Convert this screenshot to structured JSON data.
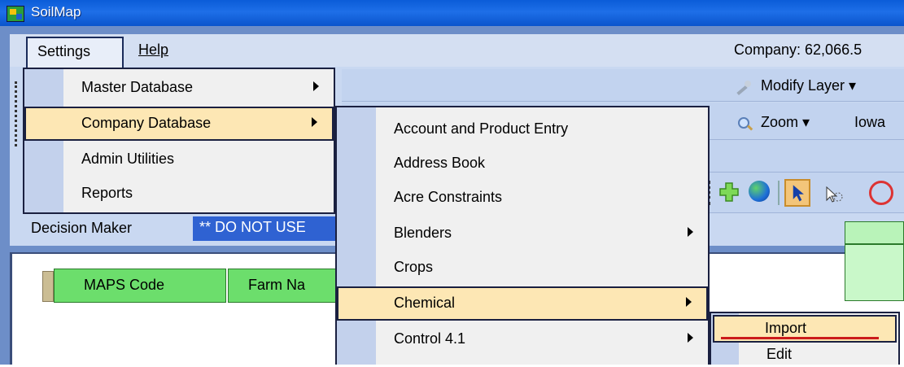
{
  "window": {
    "title": "SoilMap"
  },
  "menubar": {
    "items": [
      "Settings",
      "Help"
    ]
  },
  "status": {
    "company": "Company: 62,066.5"
  },
  "toolbar": {
    "modify_layer": "Modify Layer ▾",
    "zoom": "Zoom ▾",
    "iowa": "Iowa"
  },
  "decision_maker": {
    "label": "Decision Maker",
    "selected": "** DO NOT USE"
  },
  "grid": {
    "columns": [
      "MAPS Code",
      "Farm Na"
    ]
  },
  "settings_menu": {
    "items": [
      "Master Database",
      "Company Database",
      "Admin Utilities",
      "Reports"
    ]
  },
  "company_menu": {
    "items": [
      "Account and Product Entry",
      "Address Book",
      "Acre Constraints",
      "Blenders",
      "Crops",
      "Chemical",
      "Control 4.1"
    ]
  },
  "chemical_menu": {
    "items": [
      "Import",
      "Edit"
    ]
  },
  "colors": {
    "titlebar": "#0b5cd8",
    "menu_highlight": "#fde7b4",
    "grid_header": "#6cde6c",
    "annotation_underline": "#cc1b1b"
  }
}
